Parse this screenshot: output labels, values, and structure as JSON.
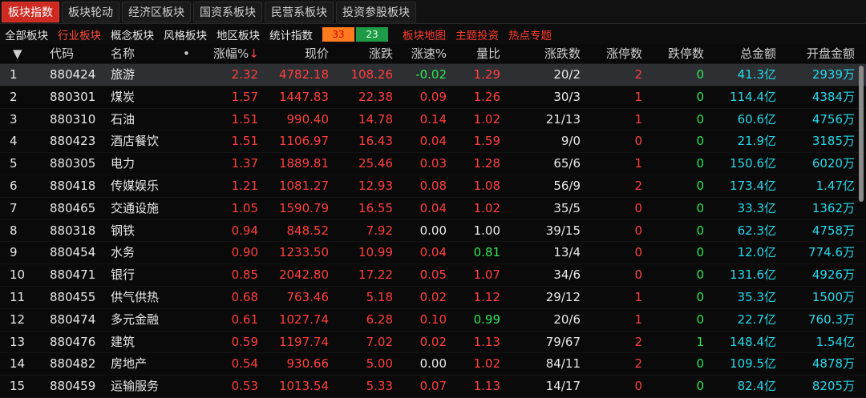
{
  "tabs": [
    {
      "label": "板块指数",
      "active": true
    },
    {
      "label": "板块轮动",
      "active": false
    },
    {
      "label": "经济区板块",
      "active": false
    },
    {
      "label": "国资系板块",
      "active": false
    },
    {
      "label": "民营系板块",
      "active": false
    },
    {
      "label": "投资参股板块",
      "active": false
    }
  ],
  "subnav": {
    "items": [
      {
        "label": "全部板块",
        "active": false
      },
      {
        "label": "行业板块",
        "active": true
      },
      {
        "label": "概念板块",
        "active": false
      },
      {
        "label": "风格板块",
        "active": false
      },
      {
        "label": "地区板块",
        "active": false
      },
      {
        "label": "统计指数",
        "active": false
      }
    ],
    "up_count": "33",
    "down_count": "23",
    "hot_links": [
      "板块地图",
      "主题投资",
      "热点专题"
    ]
  },
  "table": {
    "headers": {
      "sort": "▼",
      "code": "代码",
      "name": "名称",
      "dot": "•",
      "pct": "涨幅%",
      "sort_arrow": "↓",
      "price": "现价",
      "change": "涨跌",
      "speed": "涨速%",
      "vol_ratio": "量比",
      "up_down": "涨跌数",
      "limit_up": "涨停数",
      "limit_down": "跌停数",
      "total_amount": "总金额",
      "open_amount": "开盘金额"
    },
    "rows": [
      {
        "idx": "1",
        "code": "880424",
        "name": "旅游",
        "pct": "2.32",
        "price": "4782.18",
        "change": "108.26",
        "speed": "-0.02",
        "speed_color": "green",
        "vol_ratio": "1.29",
        "vol_color": "red",
        "up_down": "20/2",
        "limit_up": "2",
        "limit_up_color": "red",
        "limit_down": "0",
        "limit_down_color": "green",
        "total": "41.3亿",
        "open": "2939万"
      },
      {
        "idx": "2",
        "code": "880301",
        "name": "煤炭",
        "pct": "1.57",
        "price": "1447.83",
        "change": "22.38",
        "speed": "0.09",
        "speed_color": "red",
        "vol_ratio": "1.26",
        "vol_color": "red",
        "up_down": "30/3",
        "limit_up": "1",
        "limit_up_color": "red",
        "limit_down": "0",
        "limit_down_color": "green",
        "total": "114.4亿",
        "open": "4384万"
      },
      {
        "idx": "3",
        "code": "880310",
        "name": "石油",
        "pct": "1.51",
        "price": "990.40",
        "change": "14.78",
        "speed": "0.14",
        "speed_color": "red",
        "vol_ratio": "1.02",
        "vol_color": "red",
        "up_down": "21/13",
        "limit_up": "1",
        "limit_up_color": "red",
        "limit_down": "0",
        "limit_down_color": "green",
        "total": "60.6亿",
        "open": "4756万"
      },
      {
        "idx": "4",
        "code": "880423",
        "name": "酒店餐饮",
        "pct": "1.51",
        "price": "1106.97",
        "change": "16.43",
        "speed": "0.04",
        "speed_color": "red",
        "vol_ratio": "1.59",
        "vol_color": "red",
        "up_down": "9/0",
        "limit_up": "0",
        "limit_up_color": "red",
        "limit_down": "0",
        "limit_down_color": "green",
        "total": "21.9亿",
        "open": "3185万"
      },
      {
        "idx": "5",
        "code": "880305",
        "name": "电力",
        "pct": "1.37",
        "price": "1889.81",
        "change": "25.46",
        "speed": "0.03",
        "speed_color": "red",
        "vol_ratio": "1.28",
        "vol_color": "red",
        "up_down": "65/6",
        "limit_up": "1",
        "limit_up_color": "red",
        "limit_down": "0",
        "limit_down_color": "green",
        "total": "150.6亿",
        "open": "6020万"
      },
      {
        "idx": "6",
        "code": "880418",
        "name": "传媒娱乐",
        "pct": "1.21",
        "price": "1081.27",
        "change": "12.93",
        "speed": "0.08",
        "speed_color": "red",
        "vol_ratio": "1.08",
        "vol_color": "red",
        "up_down": "56/9",
        "limit_up": "2",
        "limit_up_color": "red",
        "limit_down": "0",
        "limit_down_color": "green",
        "total": "173.4亿",
        "open": "1.47亿"
      },
      {
        "idx": "7",
        "code": "880465",
        "name": "交通设施",
        "pct": "1.05",
        "price": "1590.79",
        "change": "16.55",
        "speed": "0.04",
        "speed_color": "red",
        "vol_ratio": "1.02",
        "vol_color": "red",
        "up_down": "35/5",
        "limit_up": "0",
        "limit_up_color": "red",
        "limit_down": "0",
        "limit_down_color": "green",
        "total": "33.3亿",
        "open": "1362万"
      },
      {
        "idx": "8",
        "code": "880318",
        "name": "钢铁",
        "pct": "0.94",
        "price": "848.52",
        "change": "7.92",
        "speed": "0.00",
        "speed_color": "white",
        "vol_ratio": "1.00",
        "vol_color": "white",
        "up_down": "39/15",
        "limit_up": "0",
        "limit_up_color": "red",
        "limit_down": "0",
        "limit_down_color": "green",
        "total": "62.3亿",
        "open": "4758万"
      },
      {
        "idx": "9",
        "code": "880454",
        "name": "水务",
        "pct": "0.90",
        "price": "1233.50",
        "change": "10.99",
        "speed": "0.04",
        "speed_color": "red",
        "vol_ratio": "0.81",
        "vol_color": "green",
        "up_down": "13/4",
        "limit_up": "0",
        "limit_up_color": "red",
        "limit_down": "0",
        "limit_down_color": "green",
        "total": "12.0亿",
        "open": "774.6万"
      },
      {
        "idx": "10",
        "code": "880471",
        "name": "银行",
        "pct": "0.85",
        "price": "2042.80",
        "change": "17.22",
        "speed": "0.05",
        "speed_color": "red",
        "vol_ratio": "1.07",
        "vol_color": "red",
        "up_down": "34/6",
        "limit_up": "0",
        "limit_up_color": "red",
        "limit_down": "0",
        "limit_down_color": "green",
        "total": "131.6亿",
        "open": "4926万"
      },
      {
        "idx": "11",
        "code": "880455",
        "name": "供气供热",
        "pct": "0.68",
        "price": "763.46",
        "change": "5.18",
        "speed": "0.02",
        "speed_color": "red",
        "vol_ratio": "1.12",
        "vol_color": "red",
        "up_down": "29/12",
        "limit_up": "1",
        "limit_up_color": "red",
        "limit_down": "0",
        "limit_down_color": "green",
        "total": "35.3亿",
        "open": "1500万"
      },
      {
        "idx": "12",
        "code": "880474",
        "name": "多元金融",
        "pct": "0.61",
        "price": "1027.74",
        "change": "6.28",
        "speed": "0.10",
        "speed_color": "red",
        "vol_ratio": "0.99",
        "vol_color": "green",
        "up_down": "20/6",
        "limit_up": "1",
        "limit_up_color": "red",
        "limit_down": "0",
        "limit_down_color": "green",
        "total": "22.7亿",
        "open": "760.3万"
      },
      {
        "idx": "13",
        "code": "880476",
        "name": "建筑",
        "pct": "0.59",
        "price": "1197.74",
        "change": "7.02",
        "speed": "0.02",
        "speed_color": "red",
        "vol_ratio": "1.13",
        "vol_color": "red",
        "up_down": "79/67",
        "limit_up": "2",
        "limit_up_color": "red",
        "limit_down": "1",
        "limit_down_color": "green",
        "total": "148.4亿",
        "open": "1.54亿"
      },
      {
        "idx": "14",
        "code": "880482",
        "name": "房地产",
        "pct": "0.54",
        "price": "930.66",
        "change": "5.00",
        "speed": "0.00",
        "speed_color": "white",
        "vol_ratio": "1.02",
        "vol_color": "red",
        "up_down": "84/11",
        "limit_up": "2",
        "limit_up_color": "red",
        "limit_down": "0",
        "limit_down_color": "green",
        "total": "109.5亿",
        "open": "4878万"
      },
      {
        "idx": "15",
        "code": "880459",
        "name": "运输服务",
        "pct": "0.53",
        "price": "1013.54",
        "change": "5.33",
        "speed": "0.07",
        "speed_color": "red",
        "vol_ratio": "1.13",
        "vol_color": "red",
        "up_down": "14/17",
        "limit_up": "0",
        "limit_up_color": "red",
        "limit_down": "0",
        "limit_down_color": "green",
        "total": "82.4亿",
        "open": "8205万"
      }
    ]
  },
  "colors": {
    "up": "#ff3f3f",
    "down": "#2ee656",
    "amount": "#26d8e8",
    "active_tab": "#cf2a22"
  }
}
